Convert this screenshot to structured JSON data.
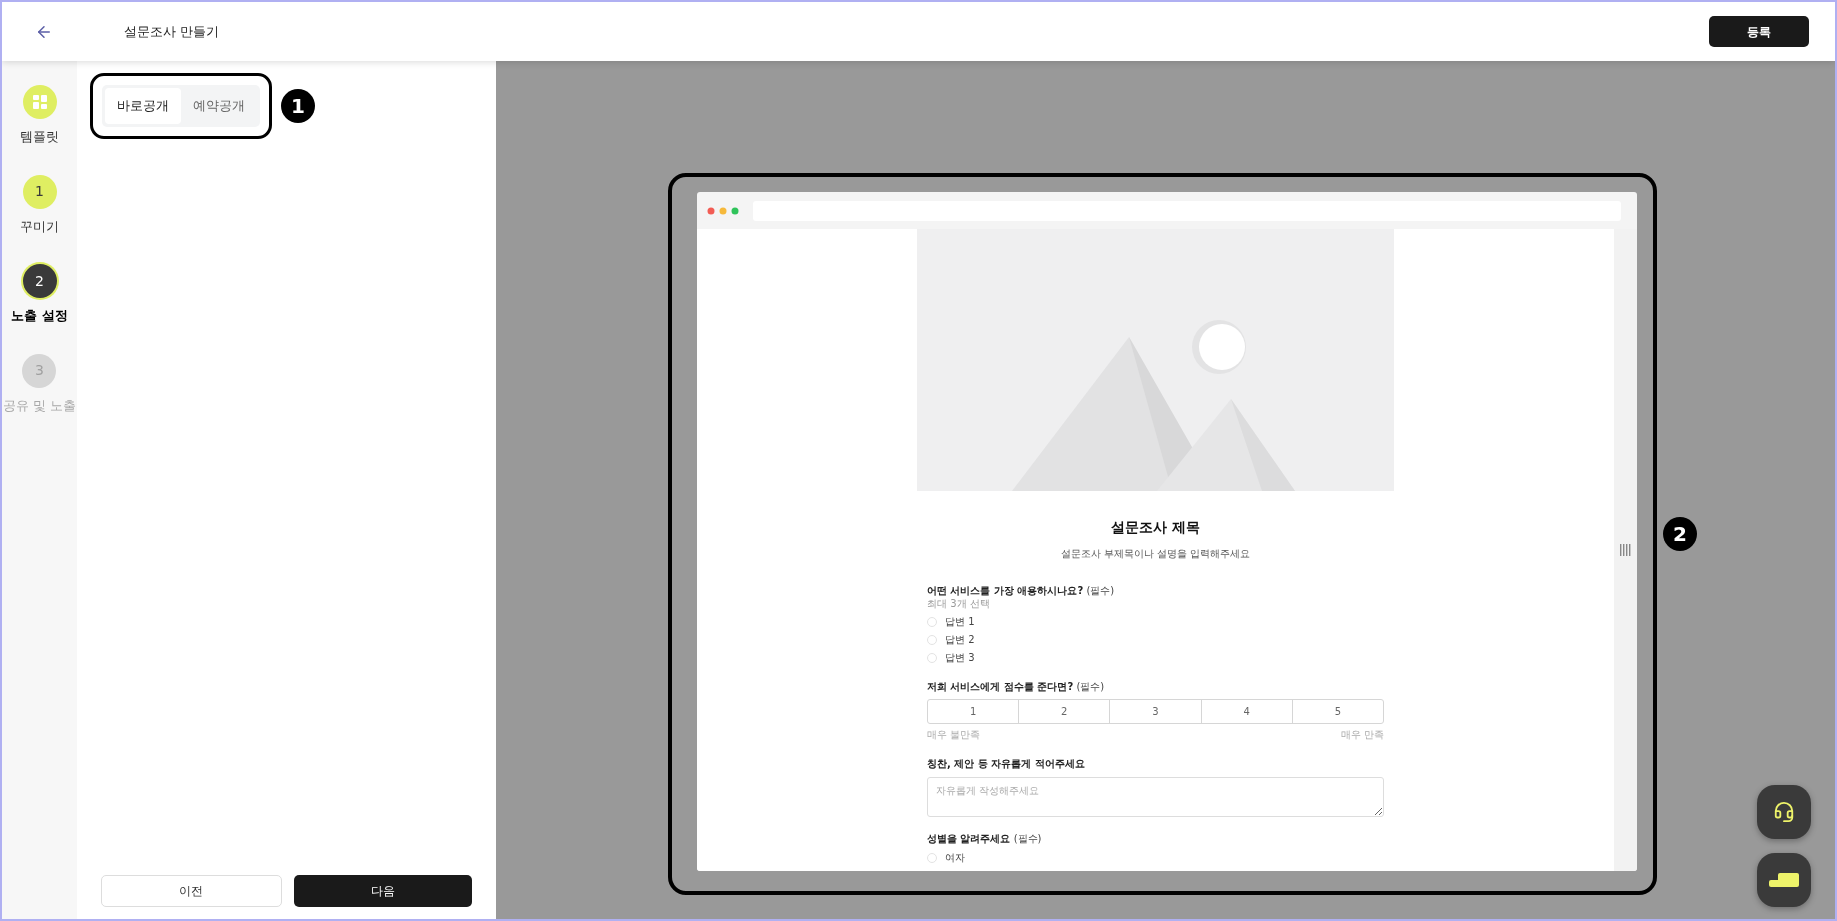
{
  "header": {
    "title": "설문조사 만들기",
    "register_button": "등록"
  },
  "steps": [
    {
      "kind": "icon",
      "label": "템플릿",
      "completed": true,
      "current": false
    },
    {
      "kind": "number",
      "number": "1",
      "label": "꾸미기",
      "completed": true,
      "current": false
    },
    {
      "kind": "number",
      "number": "2",
      "label": "노출 설정",
      "completed": false,
      "current": true
    },
    {
      "kind": "number",
      "number": "3",
      "label": "공유 및 노출",
      "completed": false,
      "current": false
    }
  ],
  "publish_tabs": [
    {
      "label": "바로공개",
      "selected": true
    },
    {
      "label": "예약공개",
      "selected": false
    }
  ],
  "callouts": [
    "1",
    "2"
  ],
  "nav_buttons": {
    "previous": "이전",
    "next": "다음"
  },
  "preview": {
    "title": "설문조사 제목",
    "subtitle": "설문조사 부제목이나 설명을 입력해주세요",
    "questions": [
      {
        "kind": "choice",
        "title": "어떤 서비스를 가장 애용하시나요?",
        "required": "(필수)",
        "hint": "최대 3개 선택",
        "options": [
          {
            "label": "답변 1",
            "selected": false
          },
          {
            "label": "답변 2",
            "selected": false
          },
          {
            "label": "답변 3",
            "selected": false
          }
        ]
      },
      {
        "kind": "scale",
        "title": "저희 서비스에게 점수를 준다면?",
        "required": "(필수)",
        "options": [
          "1",
          "2",
          "3",
          "4",
          "5"
        ],
        "low_label": "매우 불만족",
        "high_label": "매우 만족"
      },
      {
        "kind": "text",
        "title": "칭찬, 제안 등 자유롭게 적어주세요",
        "placeholder": "자유롭게 작성해주세요"
      },
      {
        "kind": "choice",
        "title": "성별을 알려주세요",
        "required": "(필수)",
        "options": [
          {
            "label": "여자",
            "selected": false
          }
        ]
      }
    ]
  }
}
